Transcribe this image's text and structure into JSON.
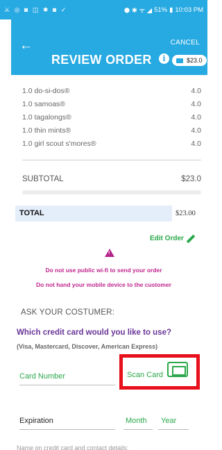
{
  "status_bar": {
    "left_icons": "⚔ ◎ ◙ ◫ ✱ ◙ ✓",
    "right_icons": "⬢ ✱ ᯤ ◢",
    "battery": "51%",
    "time": "10:03 PM"
  },
  "header": {
    "cancel_label": "CANCEL",
    "title": "REVIEW ORDER",
    "info_glyph": "i",
    "cart_total": "$23.0",
    "accent_color": "#27a9e1"
  },
  "items": [
    {
      "name": "1.0 do-si-dos®",
      "value": "4.0"
    },
    {
      "name": "1.0 samoas®",
      "value": "4.0"
    },
    {
      "name": "1.0 tagalongs®",
      "value": "4.0"
    },
    {
      "name": "1.0 thin mints®",
      "value": "4.0"
    },
    {
      "name": "1.0 girl scout s'mores®",
      "value": "4.0"
    }
  ],
  "subtotal": {
    "label": "SUBTOTAL",
    "value": "$23.0"
  },
  "total": {
    "label": "TOTAL",
    "value": "$23.00"
  },
  "edit_order_label": "Edit Order",
  "warnings": [
    "Do not use public wi-fi to send your order",
    "Do not hand your mobile device to the customer"
  ],
  "ask_label": "ASK YOUR COSTUMER:",
  "card_question": "Which credit card would you like to use?",
  "card_types": "(Visa, Mastercard, Discover, American Express)",
  "card_number_label": "Card Number",
  "scan_card_label": "Scan Card",
  "expiration_label": "Expiration",
  "month_label": "Month",
  "year_label": "Year",
  "name_label_partial": "Name on credit card and contact details:"
}
